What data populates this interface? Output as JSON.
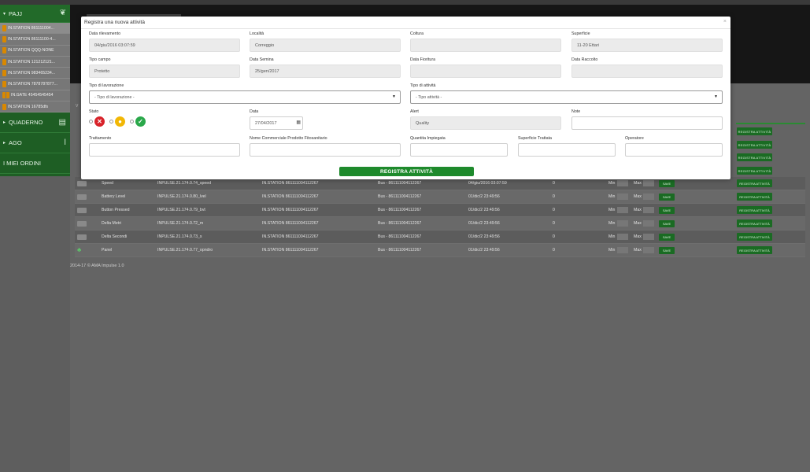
{
  "sidebar": {
    "header": "PAJJ",
    "stations": [
      "IN.STATION 861111004...",
      "IN.STATION 86111100-4...",
      "IN.STATION QQQ-NONE",
      "IN.STATION 121212121...",
      "IN.STATION 983465234...",
      "IN.STATION 7878787877...",
      "IN.GATE 45454545454",
      "IN.STATION 16785dfs"
    ],
    "sections": [
      "QUADERNO",
      "AGO",
      "I MIEI ORDINI"
    ]
  },
  "background": {
    "v_label": "V",
    "register_label": "REGISTRA ATTIVITÀ",
    "save_label": "SAVE",
    "min_label": "Min",
    "max_label": "Max",
    "rows": [
      {
        "name": "Speed",
        "address": "INPULSE.21.174.0.74_speed",
        "station": "IN.STATION 861111004112267",
        "bus": "Bus - 861111004112267",
        "date": "04/giu/2016 03:07:59",
        "value": "0"
      },
      {
        "name": "Battery Level",
        "address": "INPULSE.21.174.0.80_lvel",
        "station": "IN.STATION 861111004112267",
        "bus": "Bus - 861111004112267",
        "date": "01/dic/2 23:49:56",
        "value": "0"
      },
      {
        "name": "Button Pressed",
        "address": "INPULSE.21.174.0.79_bvt",
        "station": "IN.STATION 861111004112267",
        "bus": "Bus - 861111004112267",
        "date": "01/dic/2 23:49:56",
        "value": "0"
      },
      {
        "name": "Delta Metri",
        "address": "INPULSE.21.174.0.72_m",
        "station": "IN.STATION 861111004112267",
        "bus": "Bus - 861111004112267",
        "date": "01/dic/2 23:49:56",
        "value": "0"
      },
      {
        "name": "Delta Secondi",
        "address": "INPULSE.21.174.0.73_s",
        "station": "IN.STATION 861111004112267",
        "bus": "Bus - 861111004112267",
        "date": "01/dic/2 23:49:56",
        "value": "0"
      },
      {
        "name": "Panel",
        "address": "INPULSE.21.174.0.77_opndro",
        "station": "IN.STATION 861111004112267",
        "bus": "Bus - 861111004112267",
        "date": "01/dic/2 23:49:56",
        "value": "0"
      }
    ],
    "footer": "2014-17 © AMA Impulse 1.0"
  },
  "modal": {
    "title": "Registra una nuova attività",
    "fields": {
      "data_rilevamento": {
        "label": "Data rilevamento",
        "value": "04/giu/2016 03:07:59"
      },
      "localita": {
        "label": "Località",
        "value": "Correggio"
      },
      "coltura": {
        "label": "Coltura",
        "value": ""
      },
      "superficie": {
        "label": "Superficie",
        "value": "11-20 Ettari"
      },
      "tipo_campo": {
        "label": "Tipo campo",
        "value": "Protetto"
      },
      "data_semina": {
        "label": "Data Semina",
        "value": "25/gen/2017"
      },
      "data_fioritura": {
        "label": "Data Fioritura",
        "value": ""
      },
      "data_raccolto": {
        "label": "Data Raccolto",
        "value": ""
      },
      "tipo_lavorazione": {
        "label": "Tipo di lavorazione",
        "value": "- Tipo di lavorazione -"
      },
      "tipo_attivita": {
        "label": "Tipo di attività",
        "value": "- Tipo attività -"
      },
      "stato": {
        "label": "Stato"
      },
      "data": {
        "label": "Data",
        "value": "27/04/2017"
      },
      "alert": {
        "label": "Alert",
        "value": "Quality"
      },
      "note": {
        "label": "Note",
        "value": ""
      },
      "trattamento": {
        "label": "Trattamento",
        "value": ""
      },
      "nome_commerciale": {
        "label": "Nome Commerciale Prodotto Fitosanitario",
        "value": ""
      },
      "quantita": {
        "label": "Quantita Impiegata",
        "value": ""
      },
      "superficie_trattata": {
        "label": "Superficie Trattata",
        "value": ""
      },
      "operatore": {
        "label": "Operatore",
        "value": ""
      }
    },
    "submit_label": "REGISTRA ATTIVITÀ"
  }
}
